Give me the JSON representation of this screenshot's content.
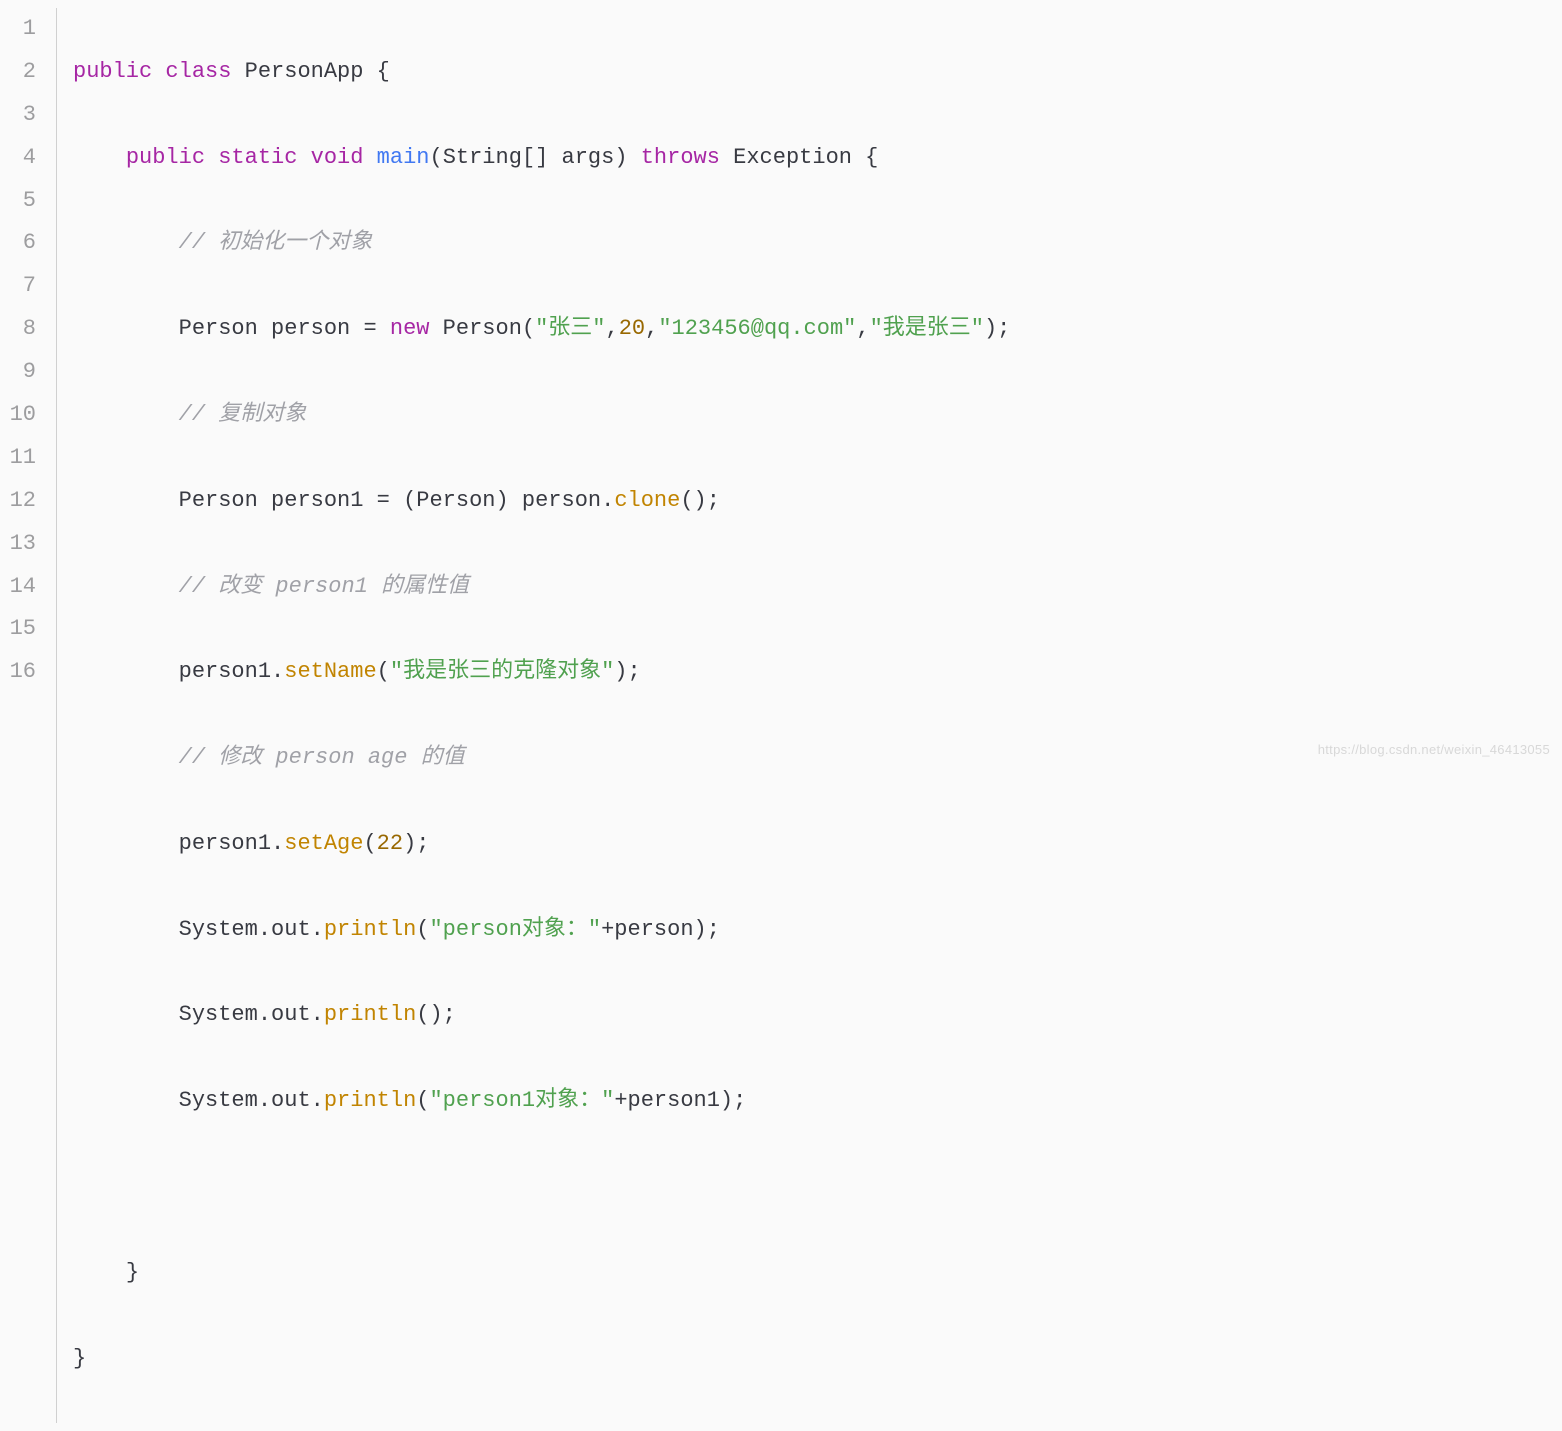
{
  "lineNumbers": [
    "1",
    "2",
    "3",
    "4",
    "5",
    "6",
    "7",
    "8",
    "9",
    "10",
    "11",
    "12",
    "13",
    "14",
    "15",
    "16"
  ],
  "tokens": {
    "l1": {
      "kw_public": "public",
      "kw_class": "class",
      "cls": "PersonApp",
      "brace": " {"
    },
    "l2": {
      "indent": "    ",
      "kw_public": "public",
      "kw_static": "static",
      "kw_void": "void",
      "method": "main",
      "paren_o": "(",
      "type": "String",
      "brackets": "[]",
      "arg": " args",
      "paren_c": ") ",
      "kw_throws": "throws",
      "exc": " Exception {"
    },
    "l3": {
      "indent": "        ",
      "comment": "// 初始化一个对象"
    },
    "l4": {
      "indent": "        ",
      "type": "Person",
      "var": " person ",
      "op": "= ",
      "kw_new": "new",
      "ctor": " Person",
      "paren_o": "(",
      "s1": "\"张三\"",
      "c1": ",",
      "n1": "20",
      "c2": ",",
      "s2": "\"123456@qq.com\"",
      "c3": ",",
      "s3": "\"我是张三\"",
      "paren_c": ");"
    },
    "l5": {
      "indent": "        ",
      "comment": "// 复制对象"
    },
    "l6": {
      "indent": "        ",
      "type": "Person",
      "var": " person1 ",
      "op": "= (",
      "cast": "Person",
      "cp": ") person.",
      "call": "clone",
      "end": "();"
    },
    "l7": {
      "indent": "        ",
      "comment": "// 改变 person1 的属性值"
    },
    "l8": {
      "indent": "        ",
      "obj": "person1.",
      "call": "setName",
      "paren_o": "(",
      "s1": "\"我是张三的克隆对象\"",
      "end": ");"
    },
    "l9": {
      "indent": "        ",
      "comment": "// 修改 person age 的值"
    },
    "l10": {
      "indent": "        ",
      "obj": "person1.",
      "call": "setAge",
      "paren_o": "(",
      "n1": "22",
      "end": ");"
    },
    "l11": {
      "indent": "        ",
      "sys": "System.out.",
      "call": "println",
      "paren_o": "(",
      "s1": "\"person对象：\"",
      "plus": "+person);"
    },
    "l12": {
      "indent": "        ",
      "sys": "System.out.",
      "call": "println",
      "end": "();"
    },
    "l13": {
      "indent": "        ",
      "sys": "System.out.",
      "call": "println",
      "paren_o": "(",
      "s1": "\"person1对象：\"",
      "plus": "+person1);"
    },
    "l14": {
      "blank": ""
    },
    "l15": {
      "indent": "    ",
      "brace": "}"
    },
    "l16": {
      "brace": "}"
    }
  },
  "watermark": "https://blog.csdn.net/weixin_46413055"
}
